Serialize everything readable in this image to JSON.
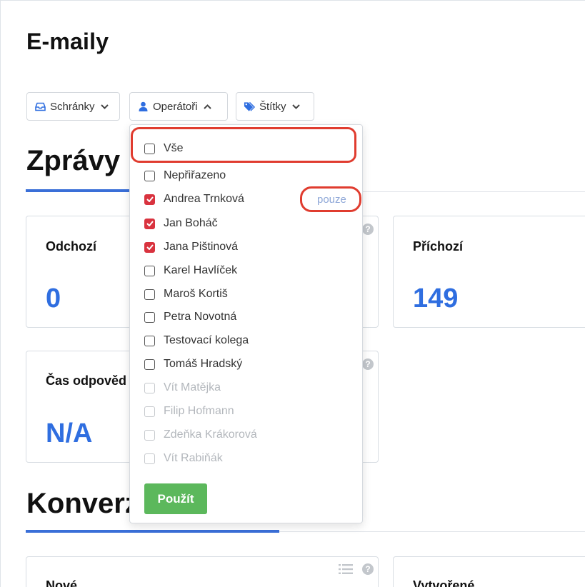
{
  "page": {
    "title": "E-maily"
  },
  "filters": {
    "schranky": {
      "label": "Schránky",
      "icon": "inbox-icon"
    },
    "operatori": {
      "label": "Operátoři",
      "icon": "user-icon",
      "open": true
    },
    "stitky": {
      "label": "Štítky",
      "icon": "tags-icon"
    }
  },
  "sections": {
    "zpravy": "Zprávy",
    "konverzace": "Konverz"
  },
  "cards": [
    {
      "label": "Odchozí",
      "value": "0"
    },
    {
      "label": "Příchozí",
      "value": "149"
    },
    {
      "label": "Čas odpověd",
      "value": "N/A"
    },
    {
      "label": "Nové"
    },
    {
      "label": "Vytvořené"
    }
  ],
  "dropdown": {
    "items": [
      {
        "label": "Vše",
        "checked": false,
        "disabled": false
      },
      {
        "label": "Nepřiřazeno",
        "checked": false,
        "disabled": false
      },
      {
        "label": "Andrea Trnková",
        "checked": true,
        "disabled": false
      },
      {
        "label": "Jan Boháč",
        "checked": true,
        "disabled": false
      },
      {
        "label": "Jana Pištinová",
        "checked": true,
        "disabled": false
      },
      {
        "label": "Karel Havlíček",
        "checked": false,
        "disabled": false
      },
      {
        "label": "Maroš Kortiš",
        "checked": false,
        "disabled": false
      },
      {
        "label": "Petra Novotná",
        "checked": false,
        "disabled": false
      },
      {
        "label": "Testovací kolega",
        "checked": false,
        "disabled": false
      },
      {
        "label": "Tomáš Hradský",
        "checked": false,
        "disabled": false
      },
      {
        "label": "Vít Matějka",
        "checked": false,
        "disabled": true
      },
      {
        "label": "Filip Hofmann",
        "checked": false,
        "disabled": true
      },
      {
        "label": "Zdeňka Krákorová",
        "checked": false,
        "disabled": true
      },
      {
        "label": "Vít Rabiňák",
        "checked": false,
        "disabled": true
      }
    ],
    "only_link": "pouze",
    "apply_label": "Použít"
  },
  "colors": {
    "accent": "#2f6ee0",
    "checked": "#d9333f",
    "apply": "#5cb85c",
    "highlight": "#e03c2f"
  }
}
